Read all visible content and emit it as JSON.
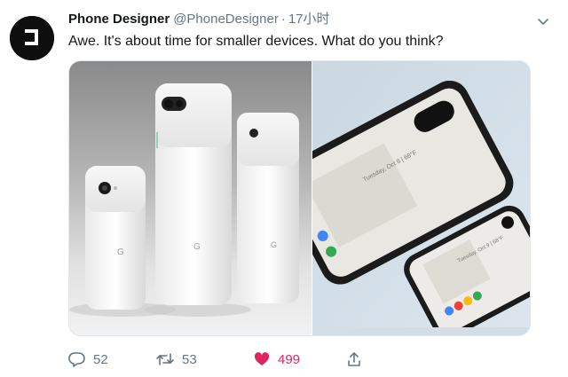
{
  "tweet": {
    "author_name": "Phone Designer",
    "author_handle": "@PhoneDesigner",
    "separator": "·",
    "timestamp": "17小时",
    "text": "Awe. It's about time for smaller devices. What do you think?",
    "media": {
      "left_image": "photo of three white phones of different sizes",
      "right_image": "photo of two phones lying on a light surface"
    },
    "actions": {
      "reply_count": "52",
      "retweet_count": "53",
      "like_count": "499"
    }
  },
  "icons": {
    "avatar": "logo-avatar",
    "caret": "chevron-down-icon",
    "reply": "reply-icon",
    "retweet": "retweet-icon",
    "like": "heart-icon",
    "share": "share-icon"
  },
  "colors": {
    "secondary_text": "#657786",
    "like_red": "#e0245e",
    "border": "#e1e8ed"
  }
}
